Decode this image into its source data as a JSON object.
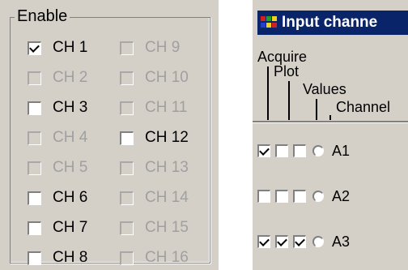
{
  "enable_group": {
    "legend": "Enable",
    "channels": [
      {
        "label": "CH 1",
        "checked": true,
        "enabled": true
      },
      {
        "label": "CH 2",
        "checked": false,
        "enabled": false
      },
      {
        "label": "CH 3",
        "checked": false,
        "enabled": true
      },
      {
        "label": "CH 4",
        "checked": false,
        "enabled": false
      },
      {
        "label": "CH 5",
        "checked": false,
        "enabled": false
      },
      {
        "label": "CH 6",
        "checked": false,
        "enabled": true
      },
      {
        "label": "CH 7",
        "checked": false,
        "enabled": true
      },
      {
        "label": "CH 8",
        "checked": false,
        "enabled": true
      },
      {
        "label": "CH 9",
        "checked": false,
        "enabled": false
      },
      {
        "label": "CH 10",
        "checked": false,
        "enabled": false
      },
      {
        "label": "CH 11",
        "checked": false,
        "enabled": false
      },
      {
        "label": "CH 12",
        "checked": false,
        "enabled": true
      },
      {
        "label": "CH 13",
        "checked": false,
        "enabled": false
      },
      {
        "label": "CH 14",
        "checked": false,
        "enabled": false
      },
      {
        "label": "CH 15",
        "checked": false,
        "enabled": false
      },
      {
        "label": "CH 16",
        "checked": false,
        "enabled": false
      }
    ]
  },
  "input_channel_window": {
    "title": "Input channe",
    "headers": {
      "acquire": "Acquire",
      "plot": "Plot",
      "values": "Values",
      "channel": "Channel"
    },
    "rows": [
      {
        "channel": "A1",
        "acquire": true,
        "plot": false,
        "values": false,
        "selected": false
      },
      {
        "channel": "A2",
        "acquire": false,
        "plot": false,
        "values": false,
        "selected": false
      },
      {
        "channel": "A3",
        "acquire": true,
        "plot": true,
        "values": true,
        "selected": false
      }
    ]
  },
  "colors": {
    "panel_bg": "#d4d0c8",
    "title_bar": "#0a246a",
    "disabled_text": "#a0a0a0"
  }
}
